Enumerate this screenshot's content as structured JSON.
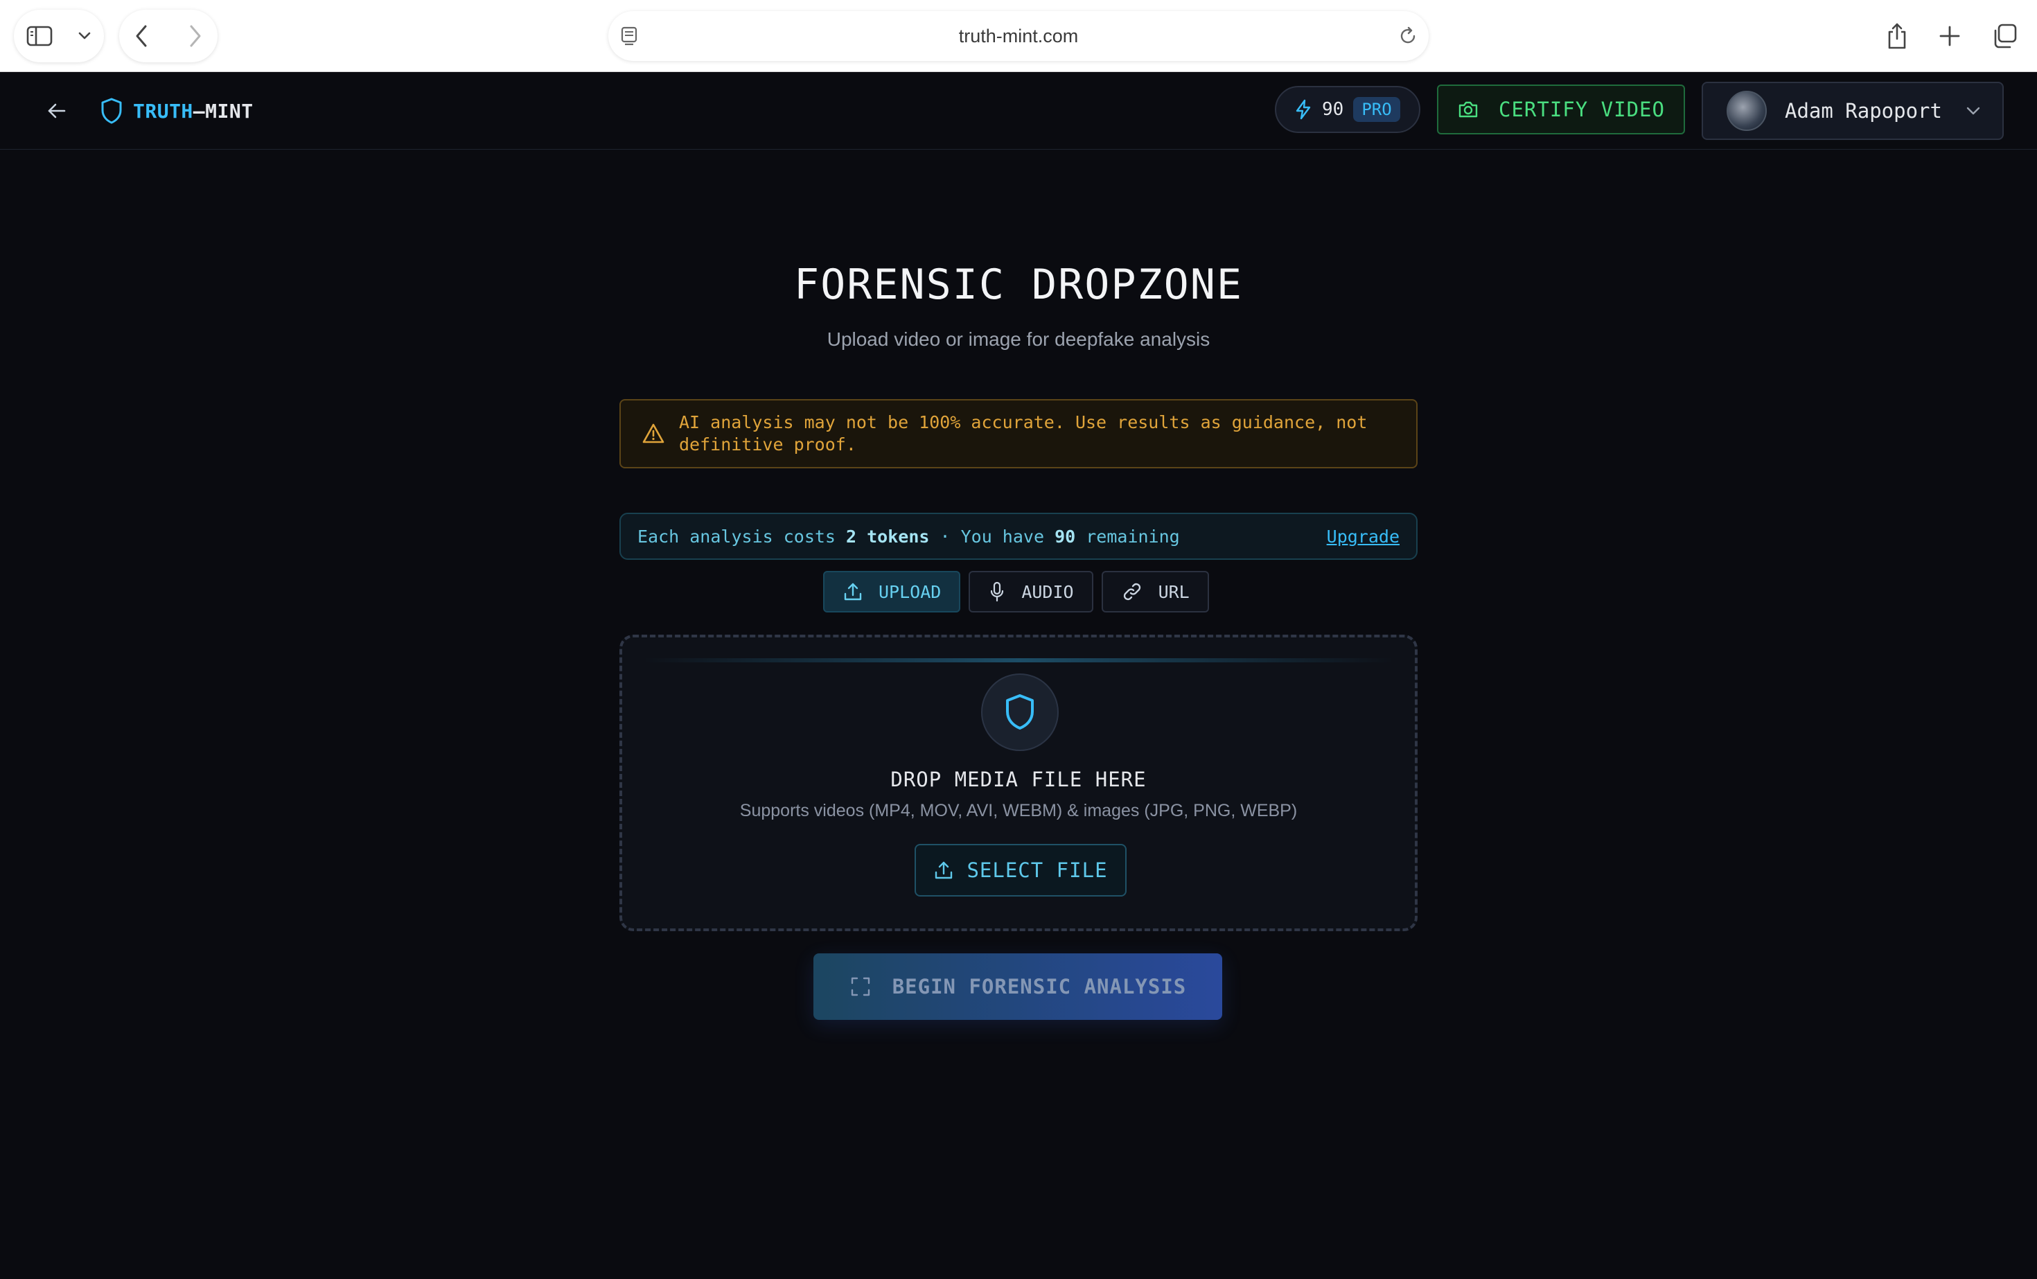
{
  "browser": {
    "url": "truth-mint.com",
    "icons": [
      "sidebar-icon",
      "chevron-down-icon",
      "back-icon",
      "forward-icon",
      "page-icon",
      "reload-icon",
      "share-icon",
      "plus-icon",
      "tabs-icon"
    ]
  },
  "header": {
    "logo_part1": "TRUTH",
    "logo_part2": "–MINT",
    "tokens": "90",
    "plan_badge": "PRO",
    "certify_label": "CERTIFY VIDEO",
    "user_name": "Adam Rapoport"
  },
  "main": {
    "title": "FORENSIC DROPZONE",
    "subtitle": "Upload video or image for deepfake analysis",
    "warning": "AI analysis may not be 100% accurate. Use results as guidance, not definitive proof.",
    "token_bar": {
      "prefix": "Each analysis costs ",
      "cost": "2 tokens",
      "middle": " · You have ",
      "remaining": "90",
      "suffix": " remaining",
      "upgrade": "Upgrade"
    },
    "tabs": [
      {
        "label": "UPLOAD",
        "active": true
      },
      {
        "label": "AUDIO",
        "active": false
      },
      {
        "label": "URL",
        "active": false
      }
    ],
    "dropzone": {
      "title": "DROP MEDIA FILE HERE",
      "subtitle": "Supports videos (MP4, MOV, AVI, WEBM) & images (JPG, PNG, WEBP)",
      "select_label": "SELECT FILE"
    },
    "begin_label": "BEGIN FORENSIC ANALYSIS"
  },
  "colors": {
    "accent": "#38bdf8",
    "certify": "#4ade80",
    "warning": "#e0a43a",
    "background": "#0a0b10"
  }
}
